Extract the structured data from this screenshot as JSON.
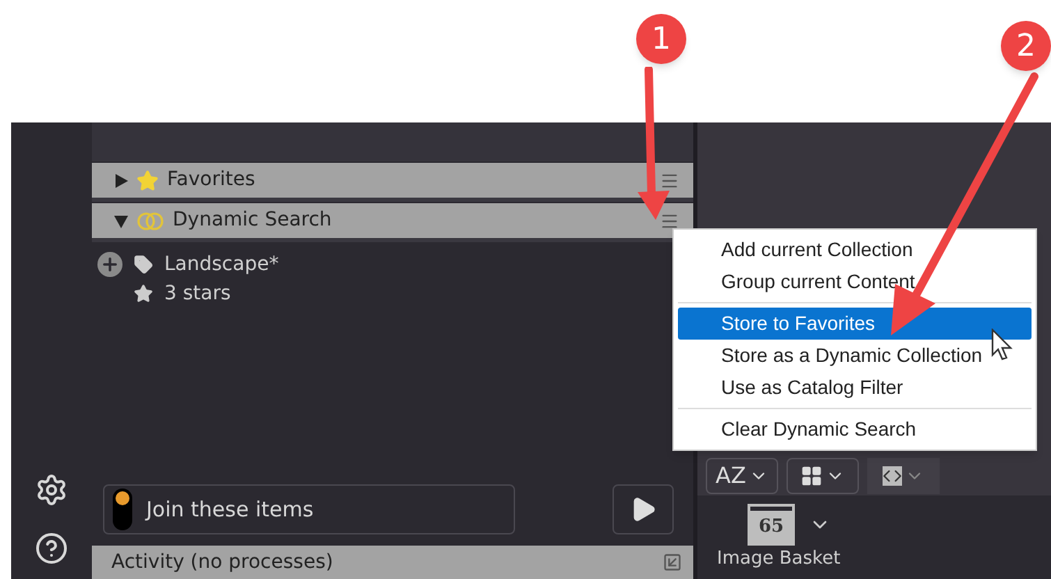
{
  "annotations": [
    {
      "label": "1"
    },
    {
      "label": "2"
    }
  ],
  "collections": [
    {
      "title": "Favorites",
      "kind": "favorites",
      "expanded": false
    },
    {
      "title": "Dynamic Search",
      "kind": "dynamic",
      "expanded": true,
      "items": [
        {
          "label": "Landscape*",
          "kind": "tag"
        },
        {
          "label": "3 stars",
          "kind": "star"
        }
      ]
    }
  ],
  "join": {
    "label": "Join these items",
    "on": true
  },
  "activity": {
    "label": "Activity (no processes)"
  },
  "toolbar": {
    "sort_label": "AZ"
  },
  "image_basket": {
    "count": "65",
    "label": "Image Basket"
  },
  "context_menu": {
    "groups": [
      [
        {
          "label": "Add current Collection",
          "selected": false
        },
        {
          "label": "Group current Content",
          "selected": false
        }
      ],
      [
        {
          "label": "Store to Favorites",
          "selected": true
        },
        {
          "label": "Store as a Dynamic Collection",
          "selected": false
        },
        {
          "label": "Use as Catalog Filter",
          "selected": false
        }
      ],
      [
        {
          "label": "Clear Dynamic Search",
          "selected": false
        }
      ]
    ]
  }
}
